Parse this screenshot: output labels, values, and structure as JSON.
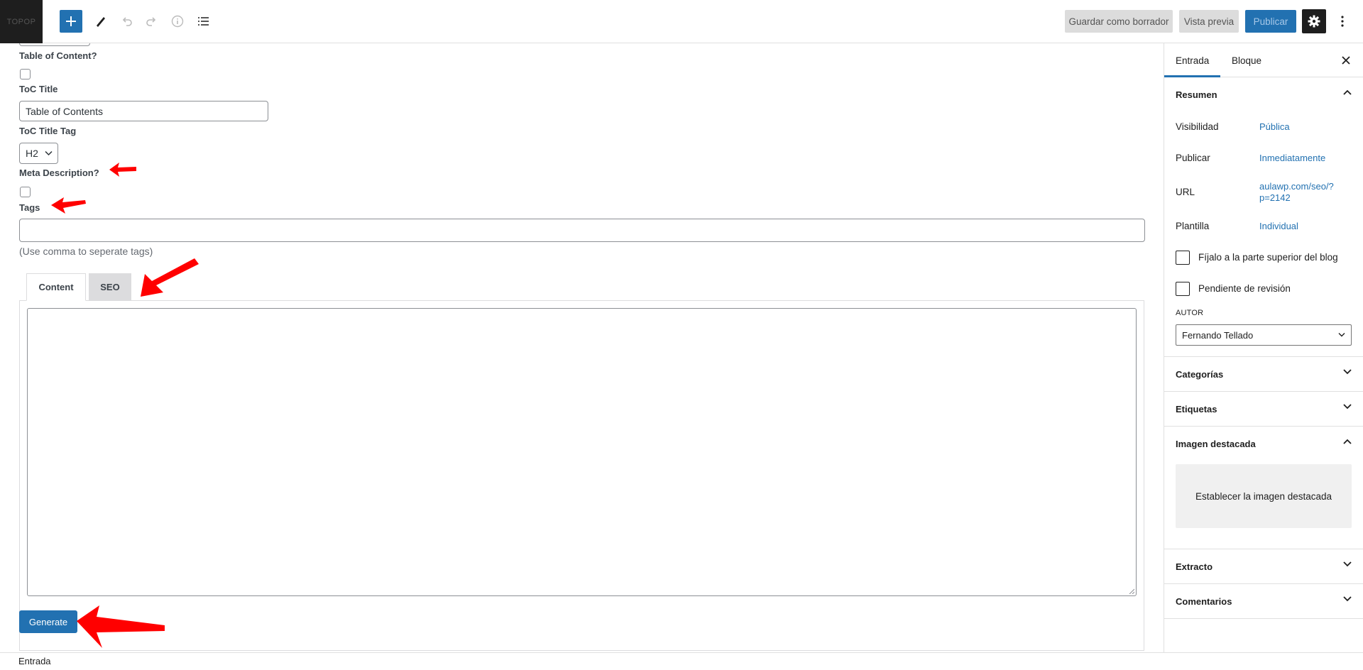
{
  "toolbar": {
    "site_logo_text": "TOPOP",
    "save_draft_label": "Guardar como borrador",
    "preview_label": "Vista previa",
    "publish_label": "Publicar"
  },
  "form": {
    "toc_question_label": "Table of Content?",
    "toc_title_label": "ToC Title",
    "toc_title_value": "Table of Contents",
    "toc_tag_label": "ToC Title Tag",
    "toc_tag_value": "H2",
    "meta_description_label": "Meta Description?",
    "tags_label": "Tags",
    "tags_value": "",
    "tags_hint": "(Use comma to seperate tags)",
    "tabs": [
      {
        "label": "Content",
        "active": true
      },
      {
        "label": "SEO",
        "active": false
      }
    ],
    "content_value": "",
    "generate_label": "Generate"
  },
  "sidebar": {
    "tabs": [
      {
        "label": "Entrada",
        "active": true
      },
      {
        "label": "Bloque",
        "active": false
      }
    ],
    "summary": {
      "title": "Resumen",
      "rows": [
        {
          "label": "Visibilidad",
          "value": "Pública"
        },
        {
          "label": "Publicar",
          "value": "Inmediatamente"
        },
        {
          "label": "URL",
          "value_line1": "aulawp.com/seo/?",
          "value_line2": "p=2142"
        },
        {
          "label": "Plantilla",
          "value": "Individual"
        }
      ],
      "checkboxes": [
        {
          "label": "Fíjalo a la parte superior del blog",
          "checked": false
        },
        {
          "label": "Pendiente de revisión",
          "checked": false
        }
      ],
      "author_label": "AUTOR",
      "author_value": "Fernando Tellado"
    },
    "panels": {
      "categories": "Categorías",
      "tags": "Etiquetas",
      "featured_image": "Imagen destacada",
      "featured_image_button": "Establecer la imagen destacada",
      "excerpt": "Extracto",
      "comments": "Comentarios"
    }
  },
  "footer": {
    "breadcrumb": "Entrada"
  },
  "colors": {
    "accent": "#2271b1",
    "annotation_arrow": "#ff0000",
    "dark": "#1e1e1e"
  }
}
